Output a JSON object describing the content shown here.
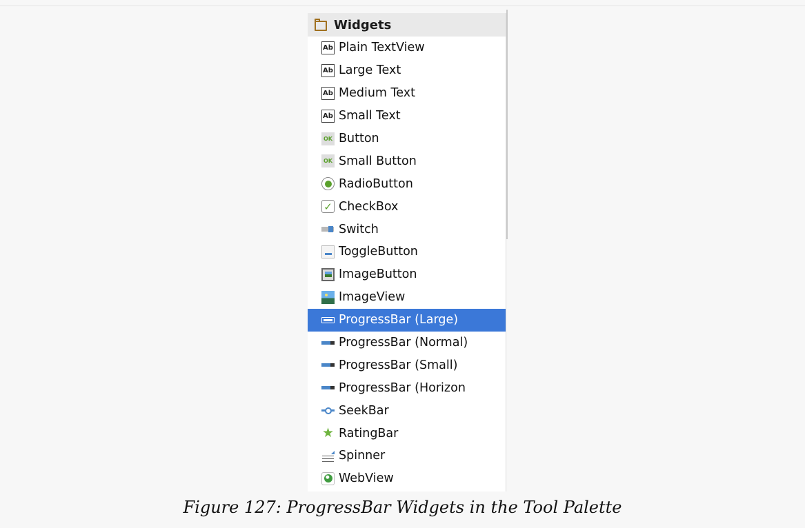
{
  "palette": {
    "header": {
      "label": "Widgets",
      "icon": "folder-icon"
    },
    "items": [
      {
        "label": "Plain TextView",
        "icon": "ab-text-icon",
        "selected": false
      },
      {
        "label": "Large Text",
        "icon": "ab-text-icon",
        "selected": false
      },
      {
        "label": "Medium Text",
        "icon": "ab-text-icon",
        "selected": false
      },
      {
        "label": "Small Text",
        "icon": "ab-text-icon",
        "selected": false
      },
      {
        "label": "Button",
        "icon": "ok-button-icon",
        "selected": false
      },
      {
        "label": "Small Button",
        "icon": "ok-button-icon",
        "selected": false
      },
      {
        "label": "RadioButton",
        "icon": "radio-button-icon",
        "selected": false
      },
      {
        "label": "CheckBox",
        "icon": "checkbox-icon",
        "selected": false
      },
      {
        "label": "Switch",
        "icon": "switch-icon",
        "selected": false
      },
      {
        "label": "ToggleButton",
        "icon": "toggle-button-icon",
        "selected": false
      },
      {
        "label": "ImageButton",
        "icon": "image-button-icon",
        "selected": false
      },
      {
        "label": "ImageView",
        "icon": "image-view-icon",
        "selected": false
      },
      {
        "label": "ProgressBar (Large)",
        "icon": "progressbar-icon",
        "selected": true
      },
      {
        "label": "ProgressBar (Normal)",
        "icon": "progressbar-icon",
        "selected": false
      },
      {
        "label": "ProgressBar (Small)",
        "icon": "progressbar-icon",
        "selected": false
      },
      {
        "label": "ProgressBar (Horizon",
        "icon": "progressbar-icon",
        "selected": false
      },
      {
        "label": "SeekBar",
        "icon": "seekbar-icon",
        "selected": false
      },
      {
        "label": "RatingBar",
        "icon": "star-icon",
        "selected": false
      },
      {
        "label": "Spinner",
        "icon": "spinner-icon",
        "selected": false
      },
      {
        "label": "WebView",
        "icon": "globe-icon",
        "selected": false
      }
    ]
  },
  "caption": "Figure 127: ProgressBar Widgets in the Tool Palette",
  "colors": {
    "selection": "#3b78d8",
    "header_bg": "#e9e9e9",
    "accent_green": "#5aa02c",
    "accent_blue": "#4a86c8"
  }
}
